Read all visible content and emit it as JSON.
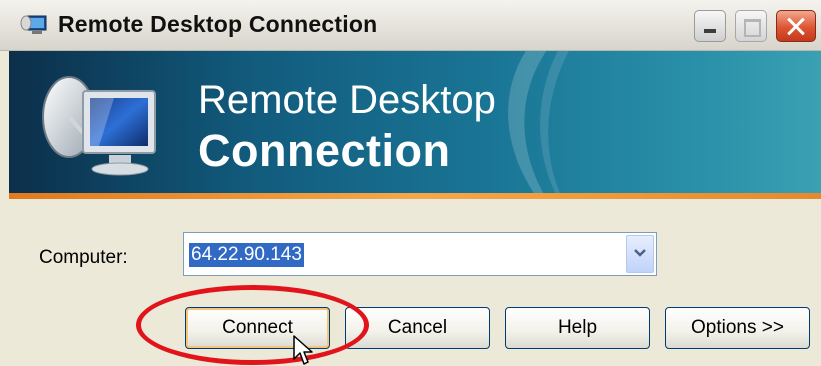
{
  "window": {
    "title": "Remote Desktop Connection",
    "icon": "remote-desktop-icon"
  },
  "titlebar_buttons": {
    "minimize_icon": "minimize-icon",
    "maximize_icon": "maximize-icon",
    "close_icon": "close-icon"
  },
  "banner": {
    "line1": "Remote Desktop",
    "line2": "Connection",
    "graphic_icon": "monitor-satellite-icon"
  },
  "form": {
    "computer_label": "Computer:",
    "computer_value": "64.22.90.143"
  },
  "buttons": {
    "connect": "Connect",
    "cancel": "Cancel",
    "help": "Help",
    "options": "Options >>"
  },
  "colors": {
    "highlight": "#e1141b",
    "banner_dark": "#0b2f4a",
    "banner_light": "#3aa0b2",
    "accent_orange": "#e07a1f"
  }
}
